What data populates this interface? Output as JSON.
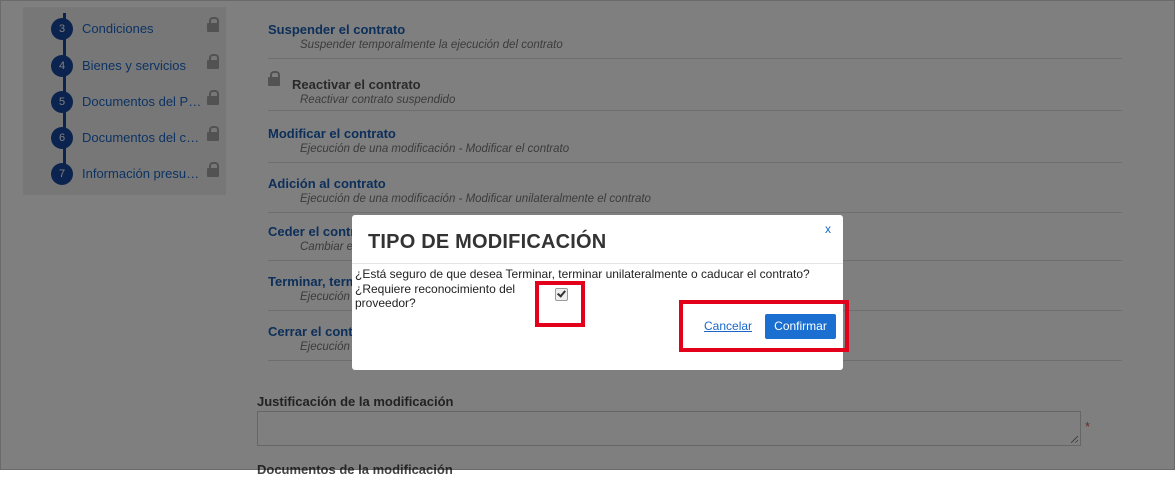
{
  "sidebar": {
    "steps": [
      {
        "num": "3",
        "label": "Condiciones"
      },
      {
        "num": "4",
        "label": "Bienes y servicios"
      },
      {
        "num": "5",
        "label": "Documentos del Proveedor"
      },
      {
        "num": "6",
        "label": "Documentos del contrato"
      },
      {
        "num": "7",
        "label": "Información presupuestal"
      }
    ]
  },
  "options": [
    {
      "title": "Suspender el contrato",
      "desc": "Suspender temporalmente la ejecución del contrato"
    },
    {
      "title": "Reactivar el contrato",
      "desc": "Reactivar contrato suspendido"
    },
    {
      "title": "Modificar el contrato",
      "desc": "Ejecución de una modificación - Modificar el contrato"
    },
    {
      "title": "Adición al contrato",
      "desc": "Ejecución de una modificación - Modificar unilateralmente el contrato"
    },
    {
      "title": "Ceder el contrato",
      "desc": "Cambiar el contratista"
    },
    {
      "title": "Terminar, terminar unilateralmente o caducar el contrato",
      "desc": "Ejecución de una modificación"
    },
    {
      "title": "Cerrar el contrato",
      "desc": "Ejecución de una modificación"
    }
  ],
  "justification": {
    "label": "Justificación de la modificación",
    "required_mark": "*"
  },
  "documents_label": "Documentos de la modificación",
  "modal": {
    "title": "TIPO DE MODIFICACIÓN",
    "close": "x",
    "question": "¿Está seguro de que desea Terminar, terminar unilateralmente o caducar el contrato?",
    "checkbox_label": "¿Requiere reconocimiento del proveedor?",
    "checkbox_checked": true,
    "cancel_label": "Cancelar",
    "confirm_label": "Confirmar"
  },
  "colors": {
    "accent": "#1a6fd1",
    "step_circle": "#17469e",
    "highlight": "#e3001b"
  }
}
